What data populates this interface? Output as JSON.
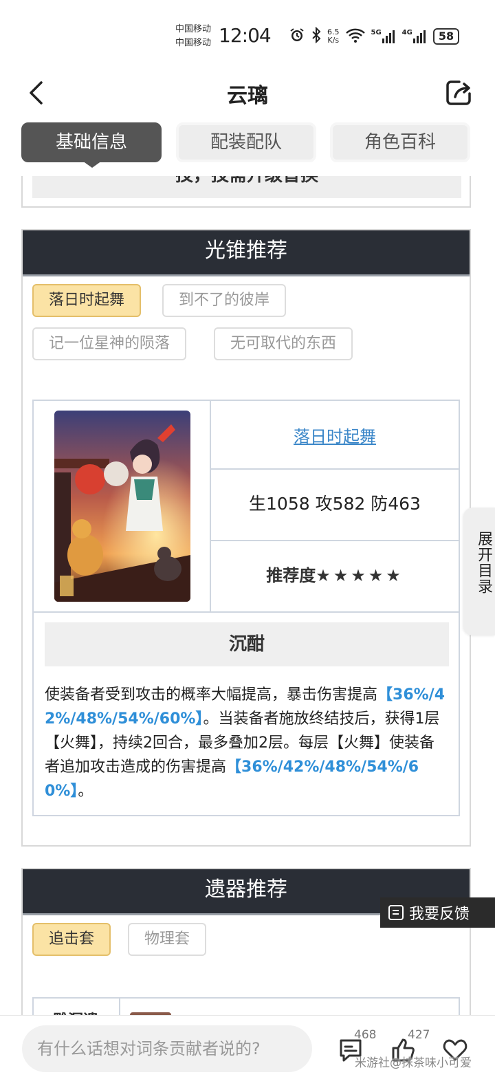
{
  "status_bar": {
    "carrier_1": "中国移动",
    "carrier_2": "中国移动",
    "time": "12:04",
    "speed_value": "6.5",
    "speed_unit": "K/s",
    "network_1": "5G",
    "network_2": "4G",
    "battery": "58"
  },
  "nav": {
    "title": "云璃"
  },
  "tabs": [
    {
      "label": "基础信息",
      "active": true
    },
    {
      "label": "配装配队",
      "active": false
    },
    {
      "label": "角色百科",
      "active": false
    }
  ],
  "prev_section": {
    "partial_text": "技，技需升级替换"
  },
  "light_cone": {
    "header": "光锥推荐",
    "chips": [
      {
        "label": "落日时起舞",
        "active": true
      },
      {
        "label": "到不了的彼岸",
        "active": false
      },
      {
        "label": "记一位星神的陨落",
        "active": false
      },
      {
        "label": "无可取代的东西",
        "active": false
      }
    ],
    "selected": {
      "name": "落日时起舞",
      "stats": "生1058 攻582 防463",
      "recommend_label": "推荐度",
      "recommend_stars": "★★★★★",
      "recommend_rating": 5,
      "skill_name": "沉酣",
      "desc": {
        "p1": "使装备者受到攻击的概率大幅提高，暴击伤害提高",
        "h1": "【36%/42%/48%/54%/60%】",
        "p2": "。当装备者施放终结技后，获得1层【火舞】，持续2回合，最多叠加2层。每层【火舞】使装备者追加攻击造成的伤害提高",
        "h2": "【36%/42%/48%/54%/60%】",
        "p3": "。"
      }
    }
  },
  "relic": {
    "header": "遗器推荐",
    "chips": [
      {
        "label": "追击套",
        "active": true
      },
      {
        "label": "物理套",
        "active": false
      }
    ],
    "row_label": "雕洞遗"
  },
  "side": {
    "toc_label": "展开目录",
    "feedback_label": "我要反馈"
  },
  "bottom_bar": {
    "comment_placeholder": "有什么话想对词条贡献者说的?",
    "comment_count": "468",
    "like_count": "427",
    "watermark": "米游社@抹茶味小可爱"
  }
}
